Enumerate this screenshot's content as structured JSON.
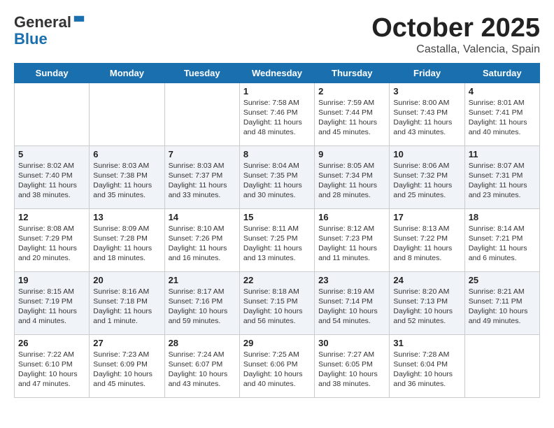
{
  "header": {
    "logo_line1": "General",
    "logo_line2": "Blue",
    "month": "October 2025",
    "location": "Castalla, Valencia, Spain"
  },
  "days_of_week": [
    "Sunday",
    "Monday",
    "Tuesday",
    "Wednesday",
    "Thursday",
    "Friday",
    "Saturday"
  ],
  "weeks": [
    [
      {
        "day": "",
        "content": ""
      },
      {
        "day": "",
        "content": ""
      },
      {
        "day": "",
        "content": ""
      },
      {
        "day": "1",
        "content": "Sunrise: 7:58 AM\nSunset: 7:46 PM\nDaylight: 11 hours\nand 48 minutes."
      },
      {
        "day": "2",
        "content": "Sunrise: 7:59 AM\nSunset: 7:44 PM\nDaylight: 11 hours\nand 45 minutes."
      },
      {
        "day": "3",
        "content": "Sunrise: 8:00 AM\nSunset: 7:43 PM\nDaylight: 11 hours\nand 43 minutes."
      },
      {
        "day": "4",
        "content": "Sunrise: 8:01 AM\nSunset: 7:41 PM\nDaylight: 11 hours\nand 40 minutes."
      }
    ],
    [
      {
        "day": "5",
        "content": "Sunrise: 8:02 AM\nSunset: 7:40 PM\nDaylight: 11 hours\nand 38 minutes."
      },
      {
        "day": "6",
        "content": "Sunrise: 8:03 AM\nSunset: 7:38 PM\nDaylight: 11 hours\nand 35 minutes."
      },
      {
        "day": "7",
        "content": "Sunrise: 8:03 AM\nSunset: 7:37 PM\nDaylight: 11 hours\nand 33 minutes."
      },
      {
        "day": "8",
        "content": "Sunrise: 8:04 AM\nSunset: 7:35 PM\nDaylight: 11 hours\nand 30 minutes."
      },
      {
        "day": "9",
        "content": "Sunrise: 8:05 AM\nSunset: 7:34 PM\nDaylight: 11 hours\nand 28 minutes."
      },
      {
        "day": "10",
        "content": "Sunrise: 8:06 AM\nSunset: 7:32 PM\nDaylight: 11 hours\nand 25 minutes."
      },
      {
        "day": "11",
        "content": "Sunrise: 8:07 AM\nSunset: 7:31 PM\nDaylight: 11 hours\nand 23 minutes."
      }
    ],
    [
      {
        "day": "12",
        "content": "Sunrise: 8:08 AM\nSunset: 7:29 PM\nDaylight: 11 hours\nand 20 minutes."
      },
      {
        "day": "13",
        "content": "Sunrise: 8:09 AM\nSunset: 7:28 PM\nDaylight: 11 hours\nand 18 minutes."
      },
      {
        "day": "14",
        "content": "Sunrise: 8:10 AM\nSunset: 7:26 PM\nDaylight: 11 hours\nand 16 minutes."
      },
      {
        "day": "15",
        "content": "Sunrise: 8:11 AM\nSunset: 7:25 PM\nDaylight: 11 hours\nand 13 minutes."
      },
      {
        "day": "16",
        "content": "Sunrise: 8:12 AM\nSunset: 7:23 PM\nDaylight: 11 hours\nand 11 minutes."
      },
      {
        "day": "17",
        "content": "Sunrise: 8:13 AM\nSunset: 7:22 PM\nDaylight: 11 hours\nand 8 minutes."
      },
      {
        "day": "18",
        "content": "Sunrise: 8:14 AM\nSunset: 7:21 PM\nDaylight: 11 hours\nand 6 minutes."
      }
    ],
    [
      {
        "day": "19",
        "content": "Sunrise: 8:15 AM\nSunset: 7:19 PM\nDaylight: 11 hours\nand 4 minutes."
      },
      {
        "day": "20",
        "content": "Sunrise: 8:16 AM\nSunset: 7:18 PM\nDaylight: 11 hours\nand 1 minute."
      },
      {
        "day": "21",
        "content": "Sunrise: 8:17 AM\nSunset: 7:16 PM\nDaylight: 10 hours\nand 59 minutes."
      },
      {
        "day": "22",
        "content": "Sunrise: 8:18 AM\nSunset: 7:15 PM\nDaylight: 10 hours\nand 56 minutes."
      },
      {
        "day": "23",
        "content": "Sunrise: 8:19 AM\nSunset: 7:14 PM\nDaylight: 10 hours\nand 54 minutes."
      },
      {
        "day": "24",
        "content": "Sunrise: 8:20 AM\nSunset: 7:13 PM\nDaylight: 10 hours\nand 52 minutes."
      },
      {
        "day": "25",
        "content": "Sunrise: 8:21 AM\nSunset: 7:11 PM\nDaylight: 10 hours\nand 49 minutes."
      }
    ],
    [
      {
        "day": "26",
        "content": "Sunrise: 7:22 AM\nSunset: 6:10 PM\nDaylight: 10 hours\nand 47 minutes."
      },
      {
        "day": "27",
        "content": "Sunrise: 7:23 AM\nSunset: 6:09 PM\nDaylight: 10 hours\nand 45 minutes."
      },
      {
        "day": "28",
        "content": "Sunrise: 7:24 AM\nSunset: 6:07 PM\nDaylight: 10 hours\nand 43 minutes."
      },
      {
        "day": "29",
        "content": "Sunrise: 7:25 AM\nSunset: 6:06 PM\nDaylight: 10 hours\nand 40 minutes."
      },
      {
        "day": "30",
        "content": "Sunrise: 7:27 AM\nSunset: 6:05 PM\nDaylight: 10 hours\nand 38 minutes."
      },
      {
        "day": "31",
        "content": "Sunrise: 7:28 AM\nSunset: 6:04 PM\nDaylight: 10 hours\nand 36 minutes."
      },
      {
        "day": "",
        "content": ""
      }
    ]
  ]
}
